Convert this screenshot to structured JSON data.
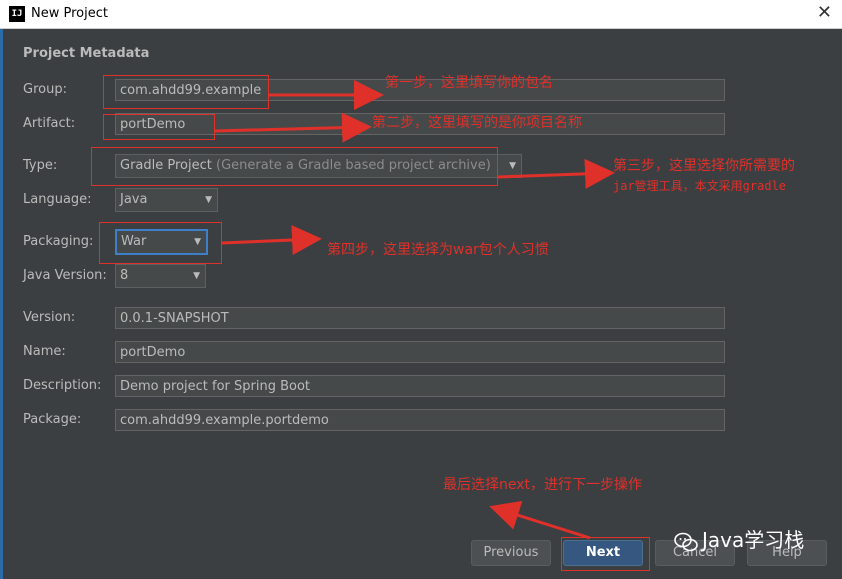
{
  "window": {
    "title": "New Project",
    "app_icon": "IJ"
  },
  "section_title": "Project Metadata",
  "fields": {
    "group": {
      "label": "Group:",
      "value": "com.ahdd99.example"
    },
    "artifact": {
      "label": "Artifact:",
      "value": "portDemo"
    },
    "type": {
      "label": "Type:",
      "value": "Gradle Project",
      "hint": "(Generate a Gradle based project archive)"
    },
    "language": {
      "label": "Language:",
      "value": "Java"
    },
    "packaging": {
      "label": "Packaging:",
      "value": "War"
    },
    "java_version": {
      "label": "Java Version:",
      "value": "8"
    },
    "version": {
      "label": "Version:",
      "value": "0.0.1-SNAPSHOT"
    },
    "name": {
      "label": "Name:",
      "value": "portDemo"
    },
    "description": {
      "label": "Description:",
      "value": "Demo project for Spring Boot"
    },
    "package": {
      "label": "Package:",
      "value": "com.ahdd99.example.portdemo"
    }
  },
  "buttons": {
    "previous": "Previous",
    "next": "Next",
    "cancel": "Cancel",
    "help": "Help"
  },
  "annotations": {
    "step1": "第一步，这里填写你的包名",
    "step2": "第二步，这里填写的是你项目名称",
    "step3_line1": "第三步，这里选择你所需要的",
    "step3_line2": "jar管理工具，本文采用gradle",
    "step4": "第四步，这里选择为war包个人习惯",
    "final": "最后选择next，进行下一步操作"
  },
  "watermark": "Java学习栈",
  "colors": {
    "annotation_red": "#e0302a",
    "dialog_bg": "#3c3f41",
    "primary_button": "#365880"
  }
}
